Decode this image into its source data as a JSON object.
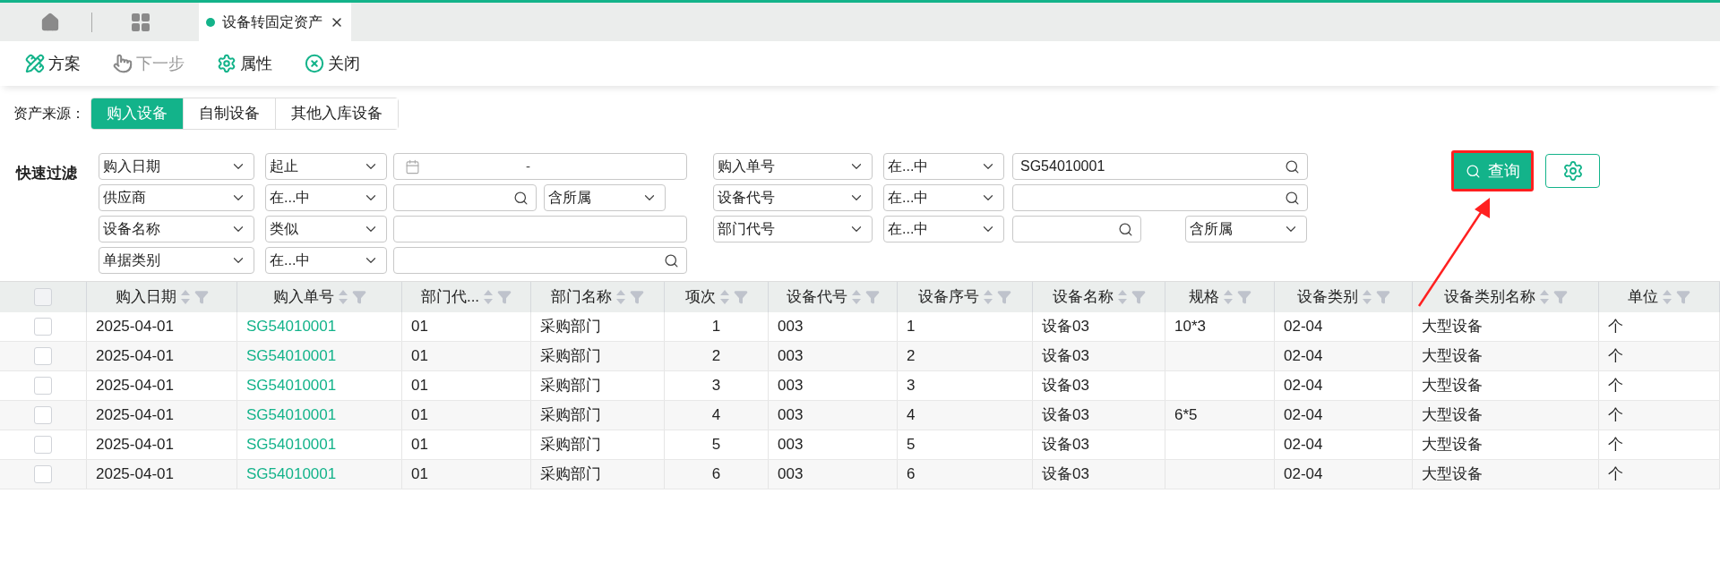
{
  "tabs": [
    {
      "label": "设备转固定资产",
      "selected": true
    }
  ],
  "toolbar": [
    {
      "label": "方案",
      "kind": "scheme",
      "disabled": false
    },
    {
      "label": "下一步",
      "kind": "next",
      "disabled": true
    },
    {
      "label": "属性",
      "kind": "settings",
      "disabled": false
    },
    {
      "label": "关闭",
      "kind": "close",
      "disabled": false
    }
  ],
  "source": {
    "label": "资产来源：",
    "options": [
      {
        "label": "购入设备",
        "selected": true
      },
      {
        "label": "自制设备",
        "selected": false
      },
      {
        "label": "其他入库设备",
        "selected": false
      }
    ]
  },
  "quick_filter": {
    "label": "快速过滤",
    "left": [
      {
        "field": "购入日期",
        "operator": "起止",
        "kind": "date",
        "separator": "-"
      },
      {
        "field": "供应商",
        "operator": "在...中",
        "kind": "search",
        "scope": "含所属"
      },
      {
        "field": "设备名称",
        "operator": "类似",
        "kind": "text"
      },
      {
        "field": "单据类别",
        "operator": "在...中",
        "kind": "search"
      }
    ],
    "right": [
      {
        "field": "购入单号",
        "operator": "在...中",
        "kind": "search",
        "value": "SG54010001"
      },
      {
        "field": "设备代号",
        "operator": "在...中",
        "kind": "search"
      },
      {
        "field": "部门代号",
        "operator": "在...中",
        "kind": "search",
        "scope": "含所属"
      }
    ]
  },
  "query_button": {
    "label": "查询",
    "highlighted": true
  },
  "table": {
    "select_all_checked": false,
    "columns": [
      {
        "label": "购入日期",
        "kind": "text"
      },
      {
        "label": "购入单号",
        "kind": "link"
      },
      {
        "label": "部门代...",
        "kind": "text"
      },
      {
        "label": "部门名称",
        "kind": "text"
      },
      {
        "label": "项次",
        "kind": "number"
      },
      {
        "label": "设备代号",
        "kind": "text"
      },
      {
        "label": "设备序号",
        "kind": "text"
      },
      {
        "label": "设备名称",
        "kind": "text"
      },
      {
        "label": "规格",
        "kind": "text"
      },
      {
        "label": "设备类别",
        "kind": "text"
      },
      {
        "label": "设备类别名称",
        "kind": "text"
      },
      {
        "label": "单位",
        "kind": "text"
      }
    ],
    "rows": [
      {
        "checked": false,
        "cells": [
          "2025-04-01",
          "SG54010001",
          "01",
          "采购部门",
          "1",
          "003",
          "1",
          "设备03",
          "10*3",
          "02-04",
          "大型设备",
          "个"
        ]
      },
      {
        "checked": false,
        "cells": [
          "2025-04-01",
          "SG54010001",
          "01",
          "采购部门",
          "2",
          "003",
          "2",
          "设备03",
          "",
          "02-04",
          "大型设备",
          "个"
        ]
      },
      {
        "checked": false,
        "cells": [
          "2025-04-01",
          "SG54010001",
          "01",
          "采购部门",
          "3",
          "003",
          "3",
          "设备03",
          "",
          "02-04",
          "大型设备",
          "个"
        ]
      },
      {
        "checked": false,
        "cells": [
          "2025-04-01",
          "SG54010001",
          "01",
          "采购部门",
          "4",
          "003",
          "4",
          "设备03",
          "6*5",
          "02-04",
          "大型设备",
          "个"
        ]
      },
      {
        "checked": false,
        "cells": [
          "2025-04-01",
          "SG54010001",
          "01",
          "采购部门",
          "5",
          "003",
          "5",
          "设备03",
          "",
          "02-04",
          "大型设备",
          "个"
        ]
      },
      {
        "checked": false,
        "cells": [
          "2025-04-01",
          "SG54010001",
          "01",
          "采购部门",
          "6",
          "003",
          "6",
          "设备03",
          "",
          "02-04",
          "大型设备",
          "个"
        ]
      }
    ]
  }
}
